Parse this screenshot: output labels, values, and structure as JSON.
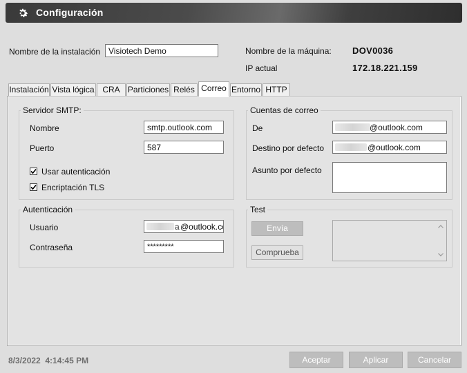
{
  "window": {
    "title": "Configuración",
    "icon": "gear-icon"
  },
  "installation": {
    "name_label": "Nombre de la instalación",
    "name_value": "Visiotech Demo",
    "machine_label": "Nombre de la máquina:",
    "machine_value": "DOV0036",
    "ip_label": "IP actual",
    "ip_value": "172.18.221.159"
  },
  "tabs": [
    {
      "label": "Instalación",
      "active": false
    },
    {
      "label": "Vista lógica",
      "active": false
    },
    {
      "label": "CRA",
      "active": false
    },
    {
      "label": "Particiones",
      "active": false
    },
    {
      "label": "Relés",
      "active": false
    },
    {
      "label": "Correo",
      "active": true
    },
    {
      "label": "Entorno",
      "active": false
    },
    {
      "label": "HTTP",
      "active": false
    }
  ],
  "smtp": {
    "legend": "Servidor SMTP:",
    "name_label": "Nombre",
    "name_value": "smtp.outlook.com",
    "port_label": "Puerto",
    "port_value": "587",
    "use_auth_label": "Usar autenticación",
    "use_auth_checked": true,
    "tls_label": "Encriptación TLS",
    "tls_checked": true
  },
  "auth": {
    "legend": "Autenticación",
    "user_label": "Usuario",
    "user_value_visible": "@outlook.co",
    "user_value_fragment": "a",
    "password_label": "Contraseña",
    "password_value": "*********"
  },
  "mail_accounts": {
    "legend": "Cuentas de correo",
    "from_label": "De",
    "from_value_visible": "@outlook.com",
    "dest_label": "Destino por defecto",
    "dest_value_visible": "@outlook.com",
    "subject_label": "Asunto por defecto",
    "subject_value": ""
  },
  "test": {
    "legend": "Test",
    "send_button": "Envía",
    "check_button": "Comprueba"
  },
  "footer": {
    "timestamp": "8/3/2022  4:14:45 PM",
    "accept_button": "Aceptar",
    "apply_button": "Aplicar",
    "cancel_button": "Cancelar"
  }
}
